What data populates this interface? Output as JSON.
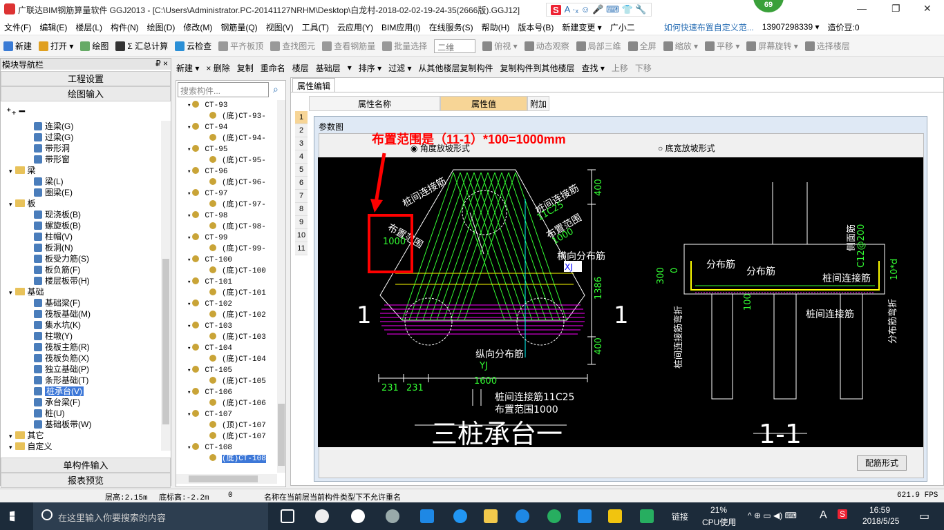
{
  "app": {
    "title": "广联达BIM钢筋算量软件 GGJ2013 - [C:\\Users\\Administrator.PC-20141127NRHM\\Desktop\\白龙村-2018-02-02-19-24-35(2666版).GGJ12]",
    "badge": "69"
  },
  "menu": [
    "文件(F)",
    "编辑(E)",
    "楼层(L)",
    "构件(N)",
    "绘图(D)",
    "修改(M)",
    "钢筋量(Q)",
    "视图(V)",
    "工具(T)",
    "云应用(Y)",
    "BIM应用(I)",
    "在线服务(S)",
    "帮助(H)",
    "版本号(B)",
    "新建变更 ▾",
    "广小二",
    "如何快速布置自定义范...",
    "13907298339 ▾",
    "造价豆:0"
  ],
  "toolbar1": [
    "新建",
    "打开 ▾",
    "绘图",
    "Σ 汇总计算",
    "云检查",
    "平齐板顶",
    "查找图元",
    "查看钢筋量",
    "批量选择",
    "二维",
    "俯视 ▾",
    "动态观察",
    "局部三维",
    "全屏",
    "缩放 ▾",
    "平移 ▾",
    "屏幕旋转 ▾",
    "选择楼层"
  ],
  "leftpanel": {
    "title": "模块导航栏",
    "pin": "₽ ×",
    "btn_project": "工程设置",
    "btn_draw": "绘图输入",
    "btn_single": "单构件输入",
    "btn_report": "报表预览",
    "tree": [
      {
        "label": "连梁(G)",
        "lvl": 2,
        "kind": "item"
      },
      {
        "label": "过梁(G)",
        "lvl": 2,
        "kind": "item"
      },
      {
        "label": "带形洞",
        "lvl": 2,
        "kind": "item"
      },
      {
        "label": "带形窗",
        "lvl": 2,
        "kind": "item"
      },
      {
        "label": "梁",
        "lvl": 1,
        "kind": "folder"
      },
      {
        "label": "梁(L)",
        "lvl": 2,
        "kind": "item"
      },
      {
        "label": "圈梁(E)",
        "lvl": 2,
        "kind": "item"
      },
      {
        "label": "板",
        "lvl": 1,
        "kind": "folder"
      },
      {
        "label": "现浇板(B)",
        "lvl": 2,
        "kind": "item"
      },
      {
        "label": "螺旋板(B)",
        "lvl": 2,
        "kind": "item"
      },
      {
        "label": "柱帽(V)",
        "lvl": 2,
        "kind": "item"
      },
      {
        "label": "板洞(N)",
        "lvl": 2,
        "kind": "item"
      },
      {
        "label": "板受力筋(S)",
        "lvl": 2,
        "kind": "item"
      },
      {
        "label": "板负筋(F)",
        "lvl": 2,
        "kind": "item"
      },
      {
        "label": "楼层板带(H)",
        "lvl": 2,
        "kind": "item"
      },
      {
        "label": "基础",
        "lvl": 1,
        "kind": "folder"
      },
      {
        "label": "基础梁(F)",
        "lvl": 2,
        "kind": "item"
      },
      {
        "label": "筏板基础(M)",
        "lvl": 2,
        "kind": "item"
      },
      {
        "label": "集水坑(K)",
        "lvl": 2,
        "kind": "item"
      },
      {
        "label": "柱墩(Y)",
        "lvl": 2,
        "kind": "item"
      },
      {
        "label": "筏板主筋(R)",
        "lvl": 2,
        "kind": "item"
      },
      {
        "label": "筏板负筋(X)",
        "lvl": 2,
        "kind": "item"
      },
      {
        "label": "独立基础(P)",
        "lvl": 2,
        "kind": "item"
      },
      {
        "label": "条形基础(T)",
        "lvl": 2,
        "kind": "item"
      },
      {
        "label": "桩承台(V)",
        "lvl": 2,
        "kind": "item",
        "selected": true
      },
      {
        "label": "承台梁(F)",
        "lvl": 2,
        "kind": "item"
      },
      {
        "label": "桩(U)",
        "lvl": 2,
        "kind": "item"
      },
      {
        "label": "基础板带(W)",
        "lvl": 2,
        "kind": "item"
      },
      {
        "label": "其它",
        "lvl": 1,
        "kind": "folder"
      },
      {
        "label": "自定义",
        "lvl": 1,
        "kind": "folder"
      }
    ]
  },
  "toolbar2": [
    "新建 ▾",
    "× 删除",
    "复制",
    "重命名",
    "楼层",
    "基础层",
    "▾",
    "排序 ▾",
    "过滤 ▾",
    "从其他楼层复制构件",
    "复制构件到其他楼层",
    "查找 ▾",
    "上移",
    "下移"
  ],
  "midpanel": {
    "search_placeholder": "搜索构件...",
    "items": [
      "CT-93",
      "(底)CT-93-",
      "CT-94",
      "(底)CT-94-",
      "CT-95",
      "(底)CT-95-",
      "CT-96",
      "(底)CT-96-",
      "CT-97",
      "(底)CT-97-",
      "CT-98",
      "(底)CT-98-",
      "CT-99",
      "(底)CT-99-",
      "CT-100",
      "(底)CT-100",
      "CT-101",
      "(底)CT-101",
      "CT-102",
      "(底)CT-102",
      "CT-103",
      "(底)CT-103",
      "CT-104",
      "(底)CT-104",
      "CT-105",
      "(底)CT-105",
      "CT-106",
      "(底)CT-106",
      "CT-107",
      "(顶)CT-107",
      "(底)CT-107",
      "CT-108",
      "(底)CT-108"
    ]
  },
  "rightpanel": {
    "tab": "属性编辑",
    "col_name": "属性名称",
    "col_value": "属性值",
    "col_add": "附加",
    "rows": [
      "1",
      "2",
      "3",
      "4",
      "5",
      "6",
      "7",
      "8",
      "9",
      "10",
      "11"
    ]
  },
  "dialog": {
    "title": "参数图",
    "radio1": "角度放坡形式",
    "radio2": "底宽放坡形式",
    "button": "配筋形式",
    "annotation": "布置范围是（11-1）*100=1000mm"
  },
  "drawing": {
    "title_left": "三桩承台一",
    "title_right": "1-1",
    "sec_mark": "1",
    "labels": {
      "a": "桩间连接筋",
      "a2": "11C25",
      "b": "布置范围",
      "b2": "1000",
      "c": "桩间连接筋",
      "c2": "布置范围",
      "c3": "1000",
      "d": "横向分布筋",
      "d2": "XJ",
      "e": "纵向分布筋",
      "e2": "YJ",
      "f": "桩间连接筋11C25",
      "g": "布置范围1000",
      "h": "400",
      "i": "1386",
      "j": "400",
      "k": "231",
      "l": "231",
      "m": "1600",
      "n": "分布筋",
      "o": "分布筋",
      "p": "桩间连接筋",
      "q": "侧面筋",
      "q2": "C12@200",
      "r": "10*d",
      "s": "分布筋弯折",
      "t": "300",
      "u": "0",
      "v": "100",
      "w": "桩间连接筋",
      "x": "桩间连接筋弯折",
      "y": "11"
    }
  },
  "status": {
    "floor_height": "层高:2.15m",
    "base_height": "底标高:-2.2m",
    "zero": "0",
    "msg": "名称在当前层当前构件类型下不允许重名",
    "fps": "621.9 FPS"
  },
  "taskbar": {
    "search": "在这里输入你要搜索的内容",
    "link": "链接",
    "cpu_pct": "21%",
    "cpu_label": "CPU使用",
    "time": "16:59",
    "date": "2018/5/25",
    "lang": "A"
  }
}
